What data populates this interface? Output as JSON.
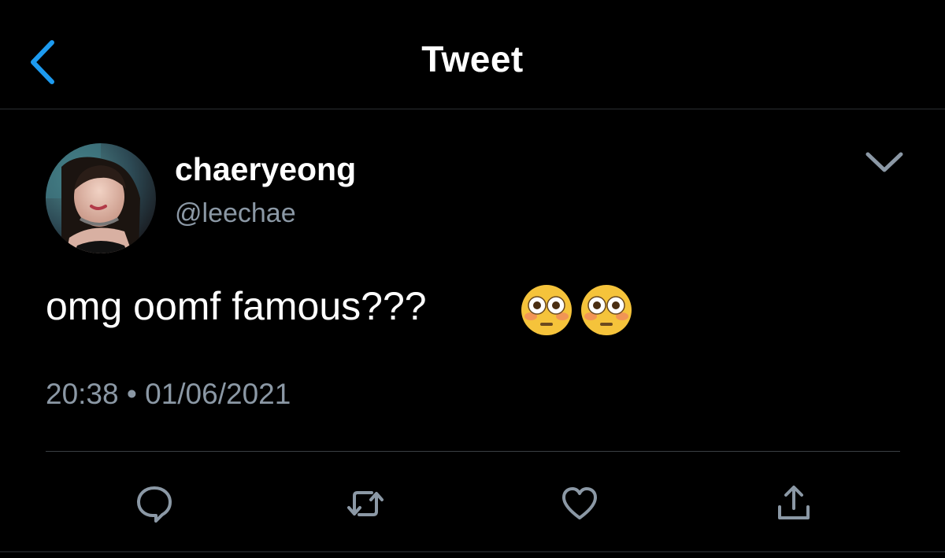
{
  "header": {
    "title": "Tweet",
    "back_icon": "chevron-left-icon"
  },
  "author": {
    "display_name": "chaeryeong",
    "handle": "@leechae",
    "avatar": "profile-photo"
  },
  "tweet": {
    "text": "omg oomf famous???",
    "emojis": [
      "flushed-face-emoji",
      "flushed-face-emoji"
    ],
    "time": "20:38",
    "separator": "•",
    "date": "01/06/2021"
  },
  "actions": {
    "reply": "reply-icon",
    "retweet": "retweet-icon",
    "like": "heart-icon",
    "share": "share-icon"
  },
  "colors": {
    "background": "#000000",
    "accent": "#1d9bf0",
    "secondary_text": "#8b98a5",
    "icon": "#8b98a5"
  }
}
